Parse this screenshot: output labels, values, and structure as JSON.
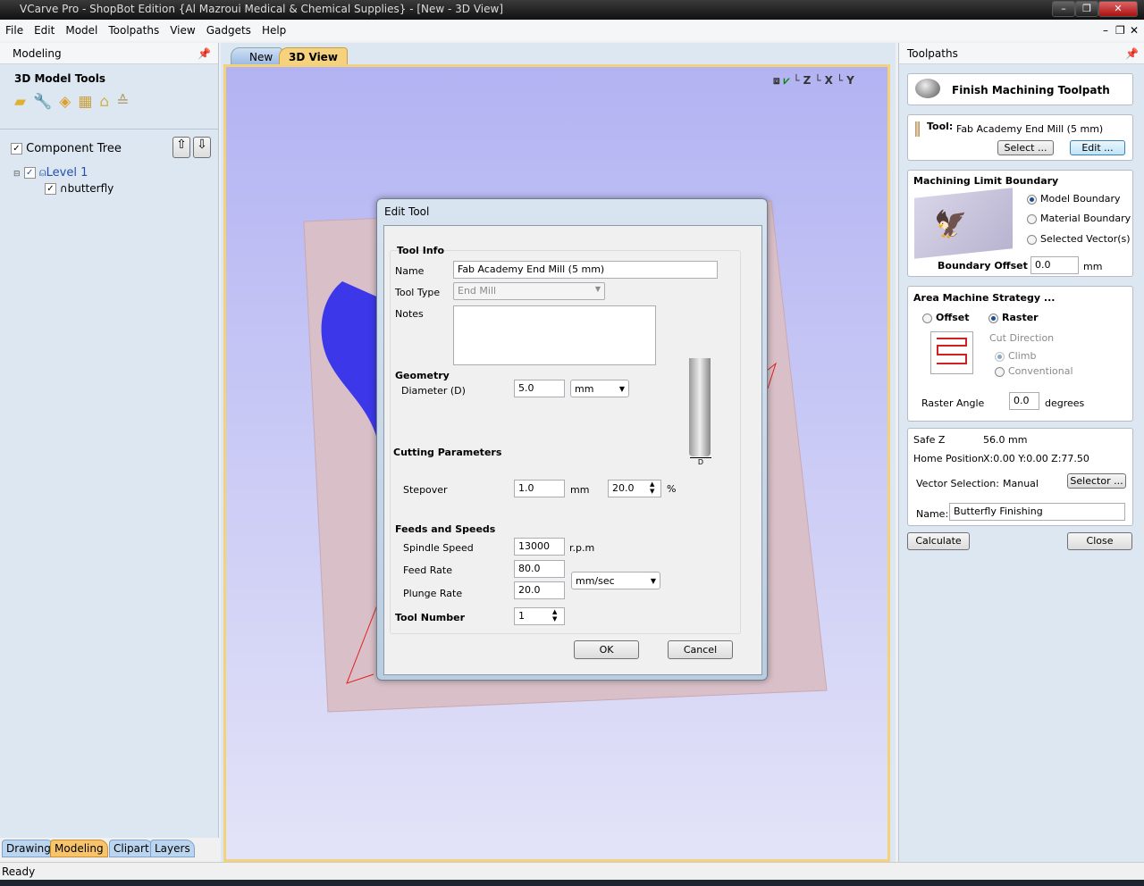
{
  "window": {
    "title": "VCarve Pro - ShopBot Edition {Al Mazroui Medical & Chemical Supplies} - [New - 3D View]"
  },
  "menu": [
    "File",
    "Edit",
    "Model",
    "Toolpaths",
    "View",
    "Gadgets",
    "Help"
  ],
  "left": {
    "header": "Modeling",
    "tools_title": "3D Model Tools",
    "tools_icons": [
      "open-folder-icon",
      "wrench-icon",
      "move-icon",
      "texture-icon",
      "bell-shape-icon",
      "layers-stack-icon"
    ],
    "tree_title": "Component Tree",
    "level": "Level 1",
    "item": "butterfly",
    "tabs": [
      "Drawing",
      "Modeling",
      "Clipart",
      "Layers"
    ],
    "active_tab": "Modeling"
  },
  "view": {
    "tabs": [
      "New",
      "3D View"
    ],
    "active_tab": "3D View",
    "view_icons": [
      "zoom-fit-icon",
      "iso-view-icon",
      "top-view-icon",
      "front-view-icon",
      "side-view-icon"
    ],
    "view_labels": [
      "",
      "",
      "Z",
      "X",
      "Y"
    ]
  },
  "dialog": {
    "title": "Edit Tool",
    "tool_info": "Tool Info",
    "name_label": "Name",
    "name_value": "Fab Academy End Mill (5 mm)",
    "type_label": "Tool Type",
    "type_value": "End Mill",
    "notes_label": "Notes",
    "notes_value": "",
    "geometry": "Geometry",
    "diameter_label": "Diameter (D)",
    "diameter_value": "5.0",
    "diameter_unit": "mm",
    "diagram_label": "D",
    "cutting": "Cutting Parameters",
    "stepover_label": "Stepover",
    "stepover_value": "1.0",
    "stepover_unit": "mm",
    "stepover_pct": "20.0",
    "pct": "%",
    "feeds": "Feeds and Speeds",
    "spindle_label": "Spindle Speed",
    "spindle_value": "13000",
    "spindle_unit": "r.p.m",
    "feed_label": "Feed Rate",
    "feed_value": "80.0",
    "plunge_label": "Plunge Rate",
    "plunge_value": "20.0",
    "rate_unit": "mm/sec",
    "toolnum_label": "Tool Number",
    "toolnum_value": "1",
    "ok": "OK",
    "cancel": "Cancel"
  },
  "right": {
    "header": "Toolpaths",
    "toolpath_title": "Finish Machining Toolpath",
    "tool_label": "Tool:",
    "tool_value": "Fab Academy End Mill (5 mm)",
    "select": "Select ...",
    "edit": "Edit ...",
    "boundary_title": "Machining Limit Boundary",
    "boundary_options": [
      "Model Boundary",
      "Material Boundary",
      "Selected Vector(s)"
    ],
    "boundary_selected": "Model Boundary",
    "offset_label": "Boundary Offset",
    "offset_value": "0.0",
    "offset_unit": "mm",
    "strategy_title": "Area Machine Strategy ...",
    "offset_opt": "Offset",
    "raster_opt": "Raster",
    "strategy_selected": "Raster",
    "cut_direction": "Cut Direction",
    "climb": "Climb",
    "conventional": "Conventional",
    "raster_angle_label": "Raster Angle",
    "raster_angle_value": "0.0",
    "raster_angle_unit": "degrees",
    "safez_label": "Safe Z",
    "safez_value": "56.0 mm",
    "home_label": "Home Position",
    "home_value": "X:0.00 Y:0.00 Z:77.50",
    "vecsel_label": "Vector Selection:",
    "vecsel_value": "Manual",
    "selector": "Selector ...",
    "name_label": "Name:",
    "name_value": "Butterfly Finishing",
    "calculate": "Calculate",
    "close": "Close"
  },
  "status": "Ready",
  "colors": {
    "accent_tab": "#f7c46c",
    "view_border": "#f3d27a",
    "panel_bg": "#dde7f2"
  }
}
